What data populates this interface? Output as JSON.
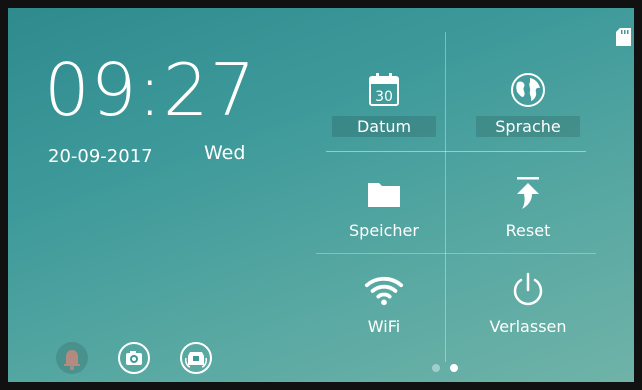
{
  "clock": {
    "time": "09:27",
    "date": "20-09-2017",
    "day": "Wed"
  },
  "menu": {
    "tiles": [
      {
        "label": "Datum",
        "icon": "calendar-icon",
        "badge": "30"
      },
      {
        "label": "Sprache",
        "icon": "globe-icon"
      },
      {
        "label": "Speicher",
        "icon": "folder-icon"
      },
      {
        "label": "Reset",
        "icon": "reset-icon"
      },
      {
        "label": "WiFi",
        "icon": "wifi-icon"
      },
      {
        "label": "Verlassen",
        "icon": "power-icon"
      }
    ]
  },
  "bottom_icons": [
    "bell-icon",
    "camera-icon",
    "intercom-icon"
  ],
  "pager": {
    "pages": 2,
    "active": 2
  },
  "status": {
    "storage_icon": "sd-card-icon"
  },
  "colors": {
    "accent": "#3e9a9a",
    "text": "#ffffff"
  }
}
